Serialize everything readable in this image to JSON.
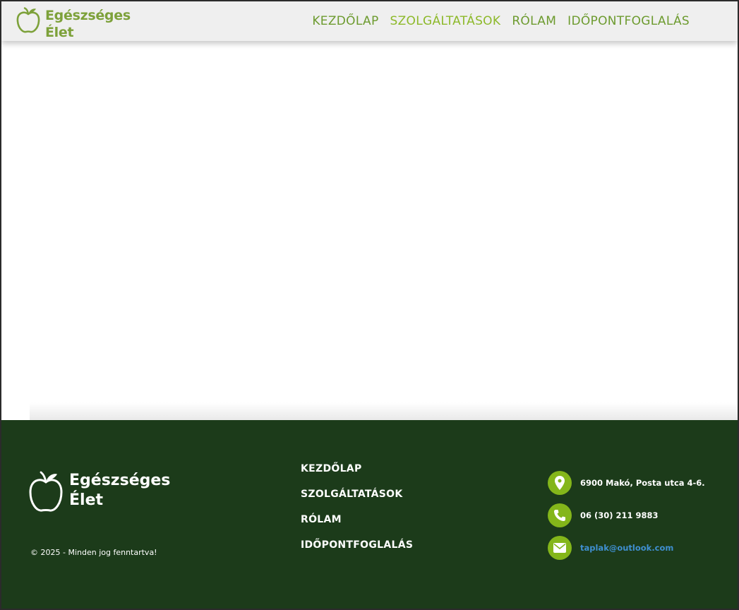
{
  "colors": {
    "header_bg": "#efefef",
    "brand_green": "#7da13a",
    "nav_green": "#6d9b2f",
    "nav_active": "#8db92a",
    "footer_bg": "#1c3b1a",
    "contact_circle": "#84b61a",
    "link_blue": "#3f8fd0"
  },
  "header": {
    "brand": {
      "line1": "Egészséges",
      "line2": "Élet",
      "icon": "apple-icon"
    },
    "nav": [
      {
        "label": "KEZDŐLAP"
      },
      {
        "label": "SZOLGÁLTATÁSOK",
        "active": true
      },
      {
        "label": "RÓLAM"
      },
      {
        "label": "IDŐPONTFOGLALÁS"
      }
    ]
  },
  "footer": {
    "brand": {
      "line1": "Egészséges",
      "line2": "Élet",
      "icon": "apple-icon"
    },
    "copyright": "© 2025 - Minden jog fenntartva!",
    "nav": [
      {
        "label": "KEZDŐLAP"
      },
      {
        "label": "SZOLGÁLTATÁSOK"
      },
      {
        "label": "RÓLAM"
      },
      {
        "label": "IDŐPONTFOGLALÁS"
      }
    ],
    "contacts": [
      {
        "icon": "location-pin-icon",
        "text": "6900 Makó, Posta utca 4-6."
      },
      {
        "icon": "phone-icon",
        "text": "06 (30) 211 9883"
      },
      {
        "icon": "envelope-icon",
        "text": "taplak@outlook.com"
      }
    ]
  }
}
